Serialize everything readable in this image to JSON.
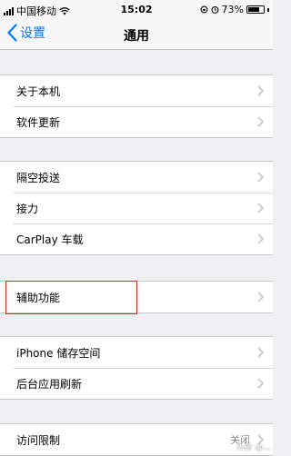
{
  "status_bar": {
    "carrier": "中国移动",
    "time": "15:02",
    "battery": "73%",
    "battery_level": 0.73
  },
  "nav": {
    "back_label": "设置",
    "title": "通用"
  },
  "groups": [
    {
      "rows": [
        {
          "label": "关于本机"
        },
        {
          "label": "软件更新"
        }
      ]
    },
    {
      "rows": [
        {
          "label": "隔空投送"
        },
        {
          "label": "接力"
        },
        {
          "label": "CarPlay 车载"
        }
      ]
    },
    {
      "rows": [
        {
          "label": "辅助功能"
        }
      ]
    },
    {
      "rows": [
        {
          "label": "iPhone 储存空间"
        },
        {
          "label": "后台应用刷新"
        }
      ]
    },
    {
      "rows": [
        {
          "label": "访问限制",
          "value": "关闭"
        }
      ]
    }
  ],
  "watermark": "头条 @...",
  "colors": {
    "accent": "#007aff",
    "highlight": "#d0302a",
    "background": "#efeff4"
  }
}
